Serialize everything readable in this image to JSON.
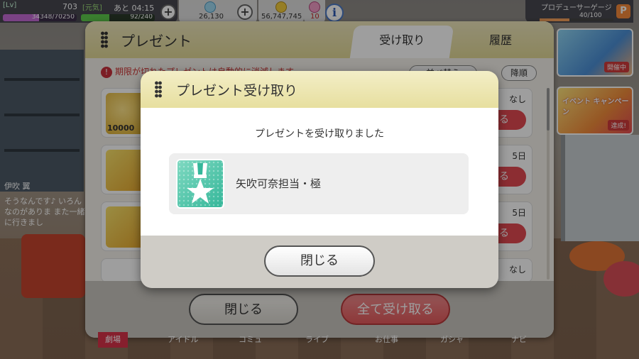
{
  "hud": {
    "lv_tag": "[Lv]",
    "level": "703",
    "genki_tag": "[元気]",
    "remain": "あと 04:15",
    "exp": "34348/70250",
    "exp_ratio": 0.49,
    "stamina": "92/240",
    "stamina_ratio": 0.38,
    "currency1": "26,130",
    "currency2": "56,747,745",
    "currency3": "10"
  },
  "producer_gauge": {
    "label": "プロデューサーゲージ",
    "value": "40/100",
    "ratio": 0.4,
    "icon_letter": "P"
  },
  "banners": [
    {
      "text": "",
      "tag": "開催中"
    },
    {
      "text": "イベント キャンペーン",
      "tag": "達成!"
    }
  ],
  "chat": {
    "name": "伊吹 翼",
    "lines": "そうなんです♪ いろんなのがありま また一緒に行きまし"
  },
  "present": {
    "title": "プレゼント",
    "tab_receive": "受け取り",
    "tab_history": "履歴",
    "notice": "期限が切れたプレゼントは自動的に消滅します",
    "sort_label": "並べ替え",
    "order_label": "降順",
    "items": [
      {
        "thumb_text": "10000",
        "right_text": "なし",
        "button": "取る"
      },
      {
        "thumb_text": "",
        "right_text": "5日",
        "button": "取る"
      },
      {
        "thumb_text": "",
        "right_text": "5日",
        "button": "取る"
      },
      {
        "thumb_text": "",
        "right_text": "なし",
        "button": ""
      }
    ],
    "close_label": "閉じる",
    "receive_all_label": "全て受け取る"
  },
  "nav": {
    "items": [
      "劇場",
      "アイドル",
      "コミュ",
      "ライブ",
      "お仕事",
      "ガシャ",
      "ナビ"
    ]
  },
  "modal": {
    "title": "プレゼント受け取り",
    "message": "プレゼントを受け取りました",
    "reward_name": "矢吹可奈担当・極",
    "reward_icon": "medal-star-icon",
    "close_label": "閉じる"
  }
}
